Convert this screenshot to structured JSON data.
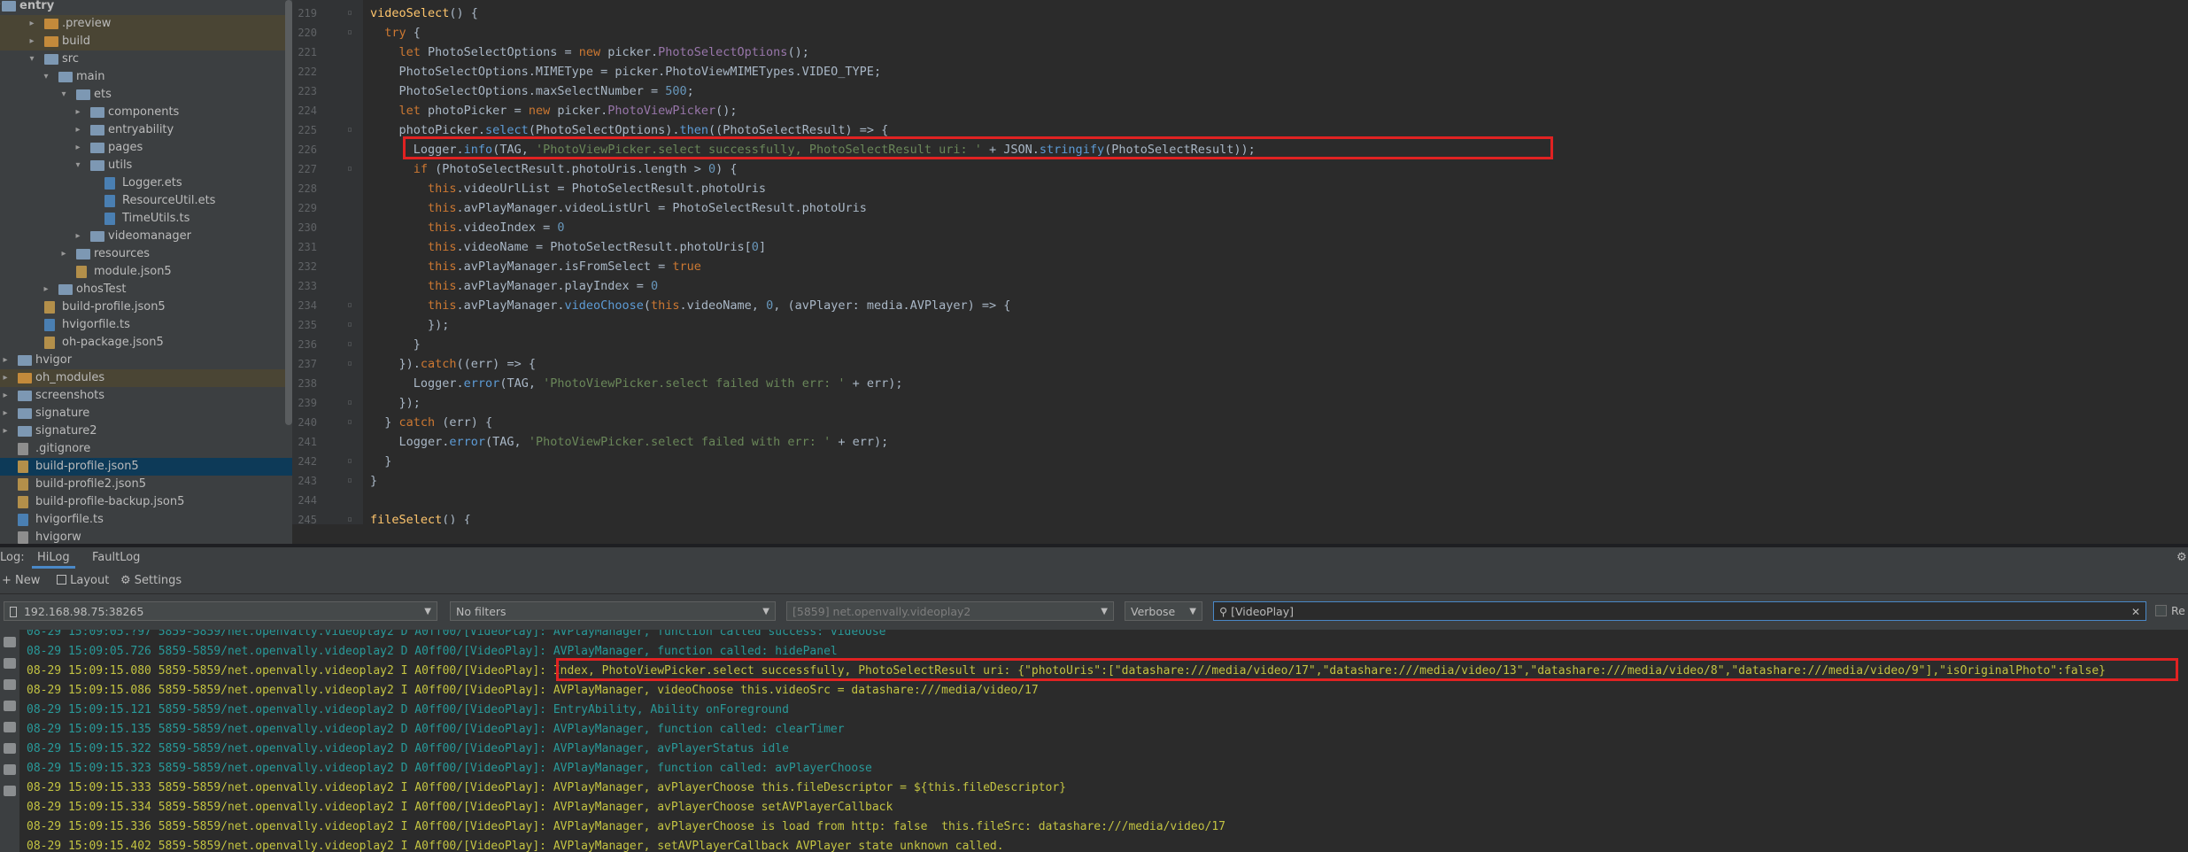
{
  "project_tree": {
    "items": [
      {
        "label": "entry",
        "icon": "folder-icon",
        "kind": "module",
        "bold": true
      },
      {
        "label": ".preview",
        "icon": "folder-icon",
        "kind": "excluded"
      },
      {
        "label": "build",
        "icon": "folder-icon",
        "kind": "excluded"
      },
      {
        "label": "src",
        "icon": "folder-icon",
        "kind": "folder"
      },
      {
        "label": "main",
        "icon": "folder-icon",
        "kind": "folder"
      },
      {
        "label": "ets",
        "icon": "folder-icon",
        "kind": "folder"
      },
      {
        "label": "components",
        "icon": "folder-icon",
        "kind": "folder"
      },
      {
        "label": "entryability",
        "icon": "folder-icon",
        "kind": "folder"
      },
      {
        "label": "pages",
        "icon": "folder-icon",
        "kind": "folder"
      },
      {
        "label": "utils",
        "icon": "folder-icon",
        "kind": "folder"
      },
      {
        "label": "Logger.ets",
        "icon": "file-icon",
        "kind": "ts"
      },
      {
        "label": "ResourceUtil.ets",
        "icon": "file-icon",
        "kind": "ts"
      },
      {
        "label": "TimeUtils.ts",
        "icon": "file-icon",
        "kind": "ts"
      },
      {
        "label": "videomanager",
        "icon": "folder-icon",
        "kind": "folder"
      },
      {
        "label": "resources",
        "icon": "folder-icon",
        "kind": "folder"
      },
      {
        "label": "module.json5",
        "icon": "file-icon",
        "kind": "json"
      },
      {
        "label": "ohosTest",
        "icon": "folder-icon",
        "kind": "folder"
      },
      {
        "label": "build-profile.json5",
        "icon": "file-icon",
        "kind": "json"
      },
      {
        "label": "hvigorfile.ts",
        "icon": "file-icon",
        "kind": "ts"
      },
      {
        "label": "oh-package.json5",
        "icon": "file-icon",
        "kind": "json"
      },
      {
        "label": "hvigor",
        "icon": "folder-icon",
        "kind": "folder"
      },
      {
        "label": "oh_modules",
        "icon": "folder-icon",
        "kind": "excluded"
      },
      {
        "label": "screenshots",
        "icon": "folder-icon",
        "kind": "folder"
      },
      {
        "label": "signature",
        "icon": "folder-icon",
        "kind": "folder"
      },
      {
        "label": "signature2",
        "icon": "folder-icon",
        "kind": "folder"
      },
      {
        "label": ".gitignore",
        "icon": "file-icon",
        "kind": "gen"
      },
      {
        "label": "build-profile.json5",
        "icon": "file-icon",
        "kind": "json",
        "selected": true
      },
      {
        "label": "build-profile2.json5",
        "icon": "file-icon",
        "kind": "json"
      },
      {
        "label": "build-profile-backup.json5",
        "icon": "file-icon",
        "kind": "json"
      },
      {
        "label": "hvigorfile.ts",
        "icon": "file-icon",
        "kind": "ts"
      },
      {
        "label": "hvigorw",
        "icon": "file-icon",
        "kind": "gen"
      }
    ]
  },
  "editor": {
    "lines": [
      {
        "n": "219",
        "code": "videoSelect() {"
      },
      {
        "n": "220",
        "code": "  try {"
      },
      {
        "n": "221",
        "code": "    let PhotoSelectOptions = new picker.PhotoSelectOptions();"
      },
      {
        "n": "222",
        "code": "    PhotoSelectOptions.MIMEType = picker.PhotoViewMIMETypes.VIDEO_TYPE;"
      },
      {
        "n": "223",
        "code": "    PhotoSelectOptions.maxSelectNumber = 500;"
      },
      {
        "n": "224",
        "code": "    let photoPicker = new picker.PhotoViewPicker();"
      },
      {
        "n": "225",
        "code": "    photoPicker.select(PhotoSelectOptions).then((PhotoSelectResult) => {"
      },
      {
        "n": "226",
        "code": "      Logger.info(TAG, 'PhotoViewPicker.select successfully, PhotoSelectResult uri: ' + JSON.stringify(PhotoSelectResult));"
      },
      {
        "n": "227",
        "code": "      if (PhotoSelectResult.photoUris.length > 0) {"
      },
      {
        "n": "228",
        "code": "        this.videoUrlList = PhotoSelectResult.photoUris"
      },
      {
        "n": "229",
        "code": "        this.avPlayManager.videoListUrl = PhotoSelectResult.photoUris"
      },
      {
        "n": "230",
        "code": "        this.videoIndex = 0"
      },
      {
        "n": "231",
        "code": "        this.videoName = PhotoSelectResult.photoUris[0]"
      },
      {
        "n": "232",
        "code": "        this.avPlayManager.isFromSelect = true"
      },
      {
        "n": "233",
        "code": "        this.avPlayManager.playIndex = 0"
      },
      {
        "n": "234",
        "code": "        this.avPlayManager.videoChoose(this.videoName, 0, (avPlayer: media.AVPlayer) => {"
      },
      {
        "n": "235",
        "code": "        });"
      },
      {
        "n": "236",
        "code": "      }"
      },
      {
        "n": "237",
        "code": "    }).catch((err) => {"
      },
      {
        "n": "238",
        "code": "      Logger.error(TAG, 'PhotoViewPicker.select failed with err: ' + err);"
      },
      {
        "n": "239",
        "code": "    });"
      },
      {
        "n": "240",
        "code": "  } catch (err) {"
      },
      {
        "n": "241",
        "code": "    Logger.error(TAG, 'PhotoViewPicker.select failed with err: ' + err);"
      },
      {
        "n": "242",
        "code": "  }"
      },
      {
        "n": "243",
        "code": "}"
      },
      {
        "n": "244",
        "code": ""
      },
      {
        "n": "245",
        "code": "fileSelect() {"
      }
    ]
  },
  "log_panel": {
    "prefix": "Log:",
    "tabs": [
      {
        "label": "HiLog",
        "active": true
      },
      {
        "label": "FaultLog",
        "active": false
      }
    ],
    "toolbar": {
      "new_label": "New",
      "layout_label": "Layout",
      "settings_label": "Settings"
    },
    "device": "192.168.98.75:38265",
    "filter": "No filters",
    "process": "[5859] net.openvally.videoplay2",
    "level": "Verbose",
    "search_value": "[VideoPlay]",
    "regex_label": "Re",
    "lines": [
      {
        "level": "D",
        "text": "08-29 15:09:05.?97 5859-5859/net.openvally.videoplay2 D A0ff00/[VideoPlay]: AVPlayManager, function called success: videoUse"
      },
      {
        "level": "D",
        "text": "08-29 15:09:05.726 5859-5859/net.openvally.videoplay2 D A0ff00/[VideoPlay]: AVPlayManager, function called: hidePanel"
      },
      {
        "level": "I",
        "text": "08-29 15:09:15.080 5859-5859/net.openvally.videoplay2 I A0ff00/[VideoPlay]: Index, PhotoViewPicker.select successfully, PhotoSelectResult uri: {\"photoUris\":[\"datashare:///media/video/17\",\"datashare:///media/video/13\",\"datashare:///media/video/8\",\"datashare:///media/video/9\"],\"isOriginalPhoto\":false}"
      },
      {
        "level": "I",
        "text": "08-29 15:09:15.086 5859-5859/net.openvally.videoplay2 I A0ff00/[VideoPlay]: AVPlayManager, videoChoose this.videoSrc = datashare:///media/video/17"
      },
      {
        "level": "D",
        "text": "08-29 15:09:15.121 5859-5859/net.openvally.videoplay2 D A0ff00/[VideoPlay]: EntryAbility, Ability onForeground"
      },
      {
        "level": "D",
        "text": "08-29 15:09:15.135 5859-5859/net.openvally.videoplay2 D A0ff00/[VideoPlay]: AVPlayManager, function called: clearTimer"
      },
      {
        "level": "D",
        "text": "08-29 15:09:15.322 5859-5859/net.openvally.videoplay2 D A0ff00/[VideoPlay]: AVPlayManager, avPlayerStatus idle"
      },
      {
        "level": "D",
        "text": "08-29 15:09:15.323 5859-5859/net.openvally.videoplay2 D A0ff00/[VideoPlay]: AVPlayManager, function called: avPlayerChoose"
      },
      {
        "level": "I",
        "text": "08-29 15:09:15.333 5859-5859/net.openvally.videoplay2 I A0ff00/[VideoPlay]: AVPlayManager, avPlayerChoose this.fileDescriptor = ${this.fileDescriptor}"
      },
      {
        "level": "I",
        "text": "08-29 15:09:15.334 5859-5859/net.openvally.videoplay2 I A0ff00/[VideoPlay]: AVPlayManager, avPlayerChoose setAVPlayerCallback"
      },
      {
        "level": "I",
        "text": "08-29 15:09:15.336 5859-5859/net.openvally.videoplay2 I A0ff00/[VideoPlay]: AVPlayManager, avPlayerChoose is load from http: false  this.fileSrc: datashare:///media/video/17"
      },
      {
        "level": "I",
        "text": "08-29 15:09:15.402 5859-5859/net.openvally.videoplay2 I A0ff00/[VideoPlay]: AVPlayManager, setAVPlayerCallback AVPlayer state unknown called."
      }
    ]
  },
  "colors": {
    "highlight_box": "#e02222",
    "log_debug": "#299999",
    "log_info": "#c3c342"
  }
}
